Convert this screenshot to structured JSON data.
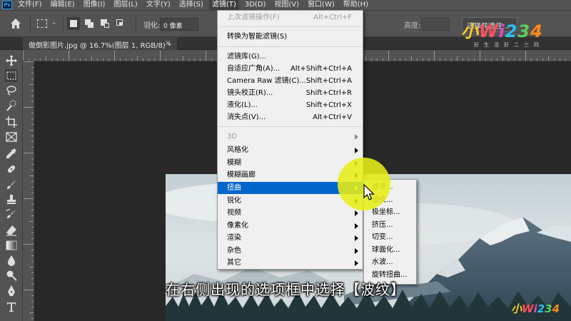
{
  "menubar": {
    "items": [
      {
        "label": "文件(F)"
      },
      {
        "label": "编辑(E)"
      },
      {
        "label": "图像(I)"
      },
      {
        "label": "图层(L)"
      },
      {
        "label": "文字(Y)"
      },
      {
        "label": "选择(S)"
      },
      {
        "label": "滤镜(T)",
        "active": true
      },
      {
        "label": "3D(D)"
      },
      {
        "label": "视图(V)"
      },
      {
        "label": "窗口(W)"
      },
      {
        "label": "帮助(H)"
      }
    ]
  },
  "options_bar": {
    "feather_label": "羽化:",
    "feather_value": "0 像素",
    "height_label": "高度:",
    "select_mask_label": "选择并遮住..."
  },
  "document_tab": {
    "title": "做倒影图片.jpg @ 16.7%(图层 1, RGB/8) *",
    "close": "×"
  },
  "filter_menu": {
    "items": [
      {
        "label": "上次滤镜操作(F)",
        "shortcut": "Alt+Ctrl+F",
        "disabled": true
      },
      {
        "label": "转换为智能滤镜(S)",
        "shortcut": ""
      },
      {
        "label": "滤镜库(G)...",
        "shortcut": ""
      },
      {
        "label": "自适应广角(A)...",
        "shortcut": "Alt+Shift+Ctrl+A"
      },
      {
        "label": "Camera Raw 滤镜(C)...",
        "shortcut": "Shift+Ctrl+A"
      },
      {
        "label": "镜头校正(R)...",
        "shortcut": "Shift+Ctrl+R"
      },
      {
        "label": "液化(L)...",
        "shortcut": "Shift+Ctrl+X"
      },
      {
        "label": "消失点(V)...",
        "shortcut": "Alt+Ctrl+V"
      },
      {
        "label": "3D",
        "submenu": true,
        "disabled": true
      },
      {
        "label": "风格化",
        "submenu": true
      },
      {
        "label": "模糊",
        "submenu": true
      },
      {
        "label": "模糊画廊",
        "submenu": true
      },
      {
        "label": "扭曲",
        "submenu": true,
        "highlighted": true
      },
      {
        "label": "锐化",
        "submenu": true
      },
      {
        "label": "视频",
        "submenu": true
      },
      {
        "label": "像素化",
        "submenu": true
      },
      {
        "label": "渲染",
        "submenu": true
      },
      {
        "label": "杂色",
        "submenu": true
      },
      {
        "label": "其它",
        "submenu": true
      }
    ]
  },
  "distort_submenu": {
    "items": [
      {
        "label": "波浪..."
      },
      {
        "label": "波纹..."
      },
      {
        "label": "极坐标..."
      },
      {
        "label": "挤压..."
      },
      {
        "label": "切变..."
      },
      {
        "label": "球面化..."
      },
      {
        "label": "水波..."
      },
      {
        "label": "旋转扭曲..."
      }
    ]
  },
  "subtitle": "在右侧出现的选项框中选择【波纹】",
  "watermark": {
    "brand": "小Wi234",
    "slogan": "好生活好二三四",
    "brand_small": "小Wi234"
  },
  "colors": {
    "menu_highlight": "#0066cc",
    "cursor_highlight": "#e6ee14",
    "ps_panel": "#535353",
    "canvas_bg": "#282828"
  }
}
